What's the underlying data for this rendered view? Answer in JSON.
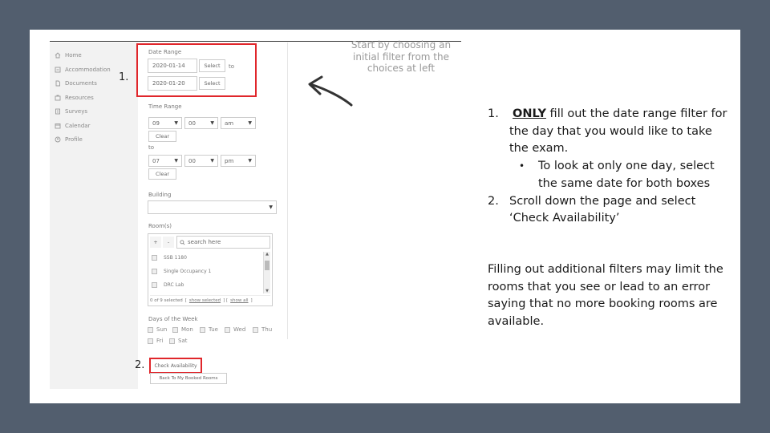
{
  "sidebar": {
    "items": [
      {
        "label": "Home",
        "icon": "home-icon"
      },
      {
        "label": "Accommodation",
        "icon": "accommodation-icon"
      },
      {
        "label": "Documents",
        "icon": "documents-icon"
      },
      {
        "label": "Resources",
        "icon": "resources-icon"
      },
      {
        "label": "Surveys",
        "icon": "surveys-icon"
      },
      {
        "label": "Calendar",
        "icon": "calendar-icon"
      },
      {
        "label": "Profile",
        "icon": "profile-icon"
      }
    ]
  },
  "form": {
    "date_range": {
      "label": "Date Range",
      "start": "2020-01-14",
      "end": "2020-01-20",
      "select_label": "Select",
      "to_label": "to"
    },
    "time_range": {
      "label": "Time Range",
      "from": {
        "hour": "09",
        "minute": "00",
        "ampm": "am"
      },
      "to_label": "to",
      "to": {
        "hour": "07",
        "minute": "00",
        "ampm": "pm"
      },
      "clear_label": "Clear"
    },
    "building": {
      "label": "Building",
      "value": ""
    },
    "rooms": {
      "label": "Room(s)",
      "plus": "+",
      "minus": "-",
      "search_placeholder": "search here",
      "items": [
        "SSB 1180",
        "Single Occupancy 1",
        "DRC Lab"
      ],
      "summary": "0 of 9 selected",
      "show_selected": "show selected",
      "show_all": "show all"
    },
    "days": {
      "label": "Days of the Week",
      "items": [
        "Sun",
        "Mon",
        "Tue",
        "Wed",
        "Thu",
        "Fri",
        "Sat"
      ]
    },
    "check_availability": "Check Availability",
    "back_button": "Back To My Booked Rooms"
  },
  "markers": {
    "step1": "1.",
    "step2": "2."
  },
  "callout": "Start by choosing an initial filter from the choices at left",
  "instructions": {
    "item1_num": "1.",
    "item1_emph": "ONLY",
    "item1_text": " fill out the date range filter for the day that you would like to take the exam.",
    "bullet": "•",
    "bullet_text": "To look at only one day, select the same date for both boxes",
    "item2_num": "2.",
    "item2_text": "Scroll down the page and select ‘Check Availability’",
    "paragraph": "Filling out additional filters may limit the rooms that you see or lead to an error saying that no more booking rooms are available."
  },
  "colors": {
    "highlight": "#e0262b",
    "frame": "#525e6e"
  }
}
